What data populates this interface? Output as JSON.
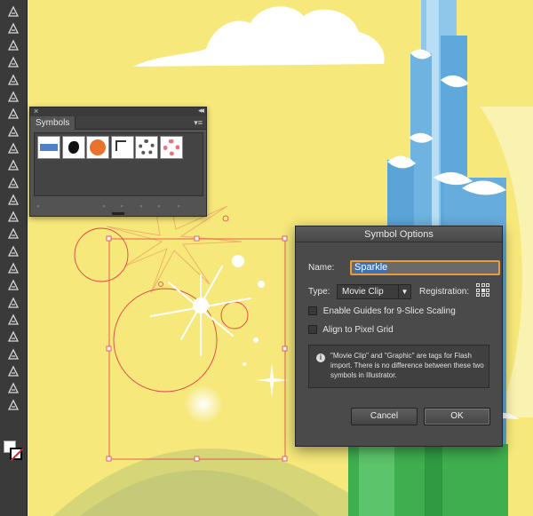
{
  "symbols_panel": {
    "tab_label": "Symbols",
    "close_glyph": "×",
    "collapse_glyph": "◂◂",
    "menu_glyph": "▾≡",
    "symbols": [
      {
        "name": "blue-banner-symbol",
        "color": "#4f7fc8"
      },
      {
        "name": "ink-splat-symbol",
        "color": "#111111"
      },
      {
        "name": "orange-button-symbol",
        "color": "#e9732a"
      },
      {
        "name": "frame-corner-symbol",
        "color": "#333333"
      },
      {
        "name": "wreath-symbol",
        "color": "#555555"
      },
      {
        "name": "pink-flower-symbol",
        "color": "#ee6f7a"
      }
    ],
    "footer_icons": [
      "library-menu-icon",
      "place-instance-icon",
      "break-link-icon",
      "symbol-options-icon",
      "new-symbol-icon",
      "delete-symbol-icon"
    ]
  },
  "dialog": {
    "title": "Symbol Options",
    "name_label": "Name:",
    "name_value": "Sparkle",
    "type_label": "Type:",
    "type_value": "Movie Clip",
    "registration_label": "Registration:",
    "slice_label": "Enable Guides for 9-Slice Scaling",
    "pixel_label": "Align to Pixel Grid",
    "slice_checked": false,
    "pixel_checked": false,
    "info_text": "\"Movie Clip\" and \"Graphic\" are tags for Flash import. There is no difference between these two symbols in Illustrator.",
    "cancel_label": "Cancel",
    "ok_label": "OK"
  },
  "colors": {
    "background": "#f6e87a",
    "selection": "#e0404a",
    "field_focus": "#e89d3a"
  },
  "toolbar": {
    "tools": [
      "pen-tool-icon",
      "artboard-tool-icon",
      "line-tool-icon",
      "ellipse-tool-icon",
      "brush-tool-icon",
      "pencil-tool-icon",
      "eraser-tool-icon",
      "scissors-tool-icon",
      "rotate-tool-icon",
      "scale-tool-icon",
      "warp-tool-icon",
      "free-transform-tool-icon",
      "shape-builder-tool-icon",
      "perspective-grid-tool-icon",
      "mesh-tool-icon",
      "gradient-tool-icon",
      "eyedropper-tool-icon",
      "blend-tool-icon",
      "symbol-sprayer-tool-icon",
      "column-graph-tool-icon",
      "artboard-tool-2-icon",
      "slice-tool-icon",
      "hand-tool-icon",
      "zoom-tool-icon"
    ]
  }
}
